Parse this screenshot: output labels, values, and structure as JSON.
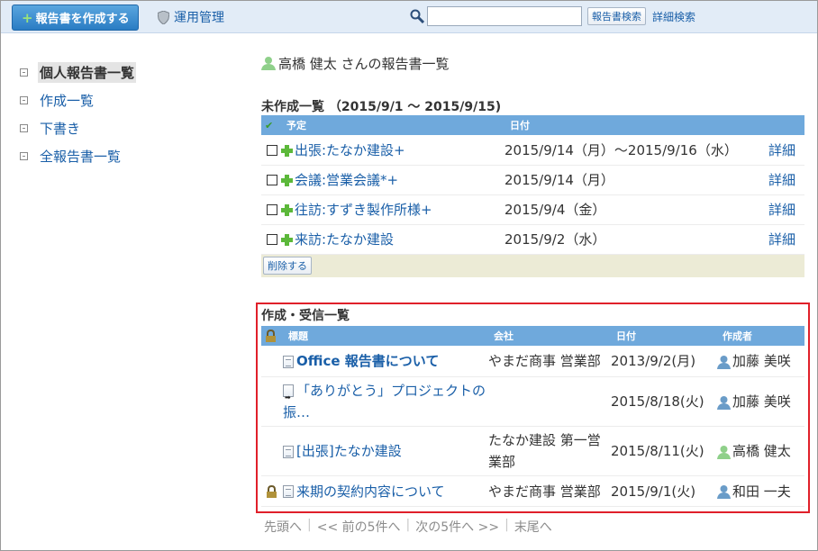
{
  "topbar": {
    "create_button": "報告書を作成する",
    "admin_link": "運用管理",
    "search_value": "",
    "search_button": "報告書検索",
    "advanced_search": "詳細検索"
  },
  "sidebar": {
    "items": [
      {
        "label": "個人報告書一覧",
        "active": true
      },
      {
        "label": "作成一覧",
        "active": false
      },
      {
        "label": "下書き",
        "active": false
      },
      {
        "label": "全報告書一覧",
        "active": false
      }
    ]
  },
  "main": {
    "user_heading": "高橋 健太 さんの報告書一覧",
    "unmade": {
      "title": "未作成一覧 （2015/9/1 ～ 2015/9/15)",
      "headers": {
        "plan": "予定",
        "date": "日付"
      },
      "rows": [
        {
          "plan": "出張:たなか建設+",
          "date": "2015/9/14（月）～2015/9/16（水）",
          "detail": "詳細"
        },
        {
          "plan": "会議:営業会議*+",
          "date": "2015/9/14（月）",
          "detail": "詳細"
        },
        {
          "plan": "往訪:すずき製作所様+",
          "date": "2015/9/4（金）",
          "detail": "詳細"
        },
        {
          "plan": "来訪:たなか建設",
          "date": "2015/9/2（水）",
          "detail": "詳細"
        }
      ],
      "delete_button": "削除する"
    },
    "received": {
      "title": "作成・受信一覧",
      "headers": {
        "subject": "標題",
        "company": "会社",
        "date": "日付",
        "author": "作成者"
      },
      "rows": [
        {
          "subject": "Office 報告書について",
          "company": "やまだ商事 営業部",
          "date": "2013/9/2(月)",
          "author": "加藤 美咲",
          "bold": true,
          "lock": false,
          "icon": "doc-icon",
          "author_color": "#6a9cc8"
        },
        {
          "subject": "「ありがとう」プロジェクトの振…",
          "company": "",
          "date": "2015/8/18(火)",
          "author": "加藤 美咲",
          "bold": false,
          "lock": false,
          "icon": "forward-doc-icon",
          "author_color": "#6a9cc8"
        },
        {
          "subject": "[出張]たなか建設",
          "company": "たなか建設 第一営業部",
          "date": "2015/8/11(火)",
          "author": "高橋 健太",
          "bold": false,
          "lock": false,
          "icon": "doc-icon",
          "author_color": "#8fd08a"
        },
        {
          "subject": "来期の契約内容について",
          "company": "やまだ商事 営業部",
          "date": "2015/9/1(火)",
          "author": "和田 一夫",
          "bold": false,
          "lock": true,
          "icon": "doc-icon",
          "author_color": "#6a9cc8"
        }
      ]
    },
    "pager": {
      "first": "先頭へ",
      "prev": "<< 前の5件へ",
      "next": "次の5件へ >>",
      "last": "末尾へ"
    }
  },
  "colors": {
    "header": "#6fa9dc",
    "link": "#1a5fa8",
    "highlight_border": "#e0202a",
    "footer_bar": "#ecebd6"
  }
}
